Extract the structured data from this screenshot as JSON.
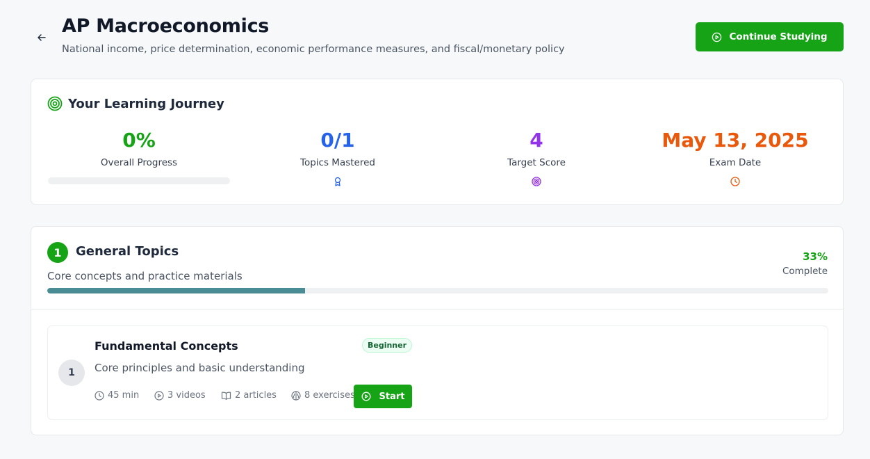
{
  "header": {
    "title": "AP Macroeconomics",
    "subtitle": "National income, price determination, economic performance measures, and fiscal/monetary policy",
    "continue_label": "Continue Studying"
  },
  "journey": {
    "title": "Your Learning Journey",
    "stats": [
      {
        "value": "0%",
        "label": "Overall Progress",
        "color": "#16a316",
        "progress": 0
      },
      {
        "value": "0/1",
        "label": "Topics Mastered",
        "color": "#2563eb",
        "icon": "award-icon"
      },
      {
        "value": "4",
        "label": "Target Score",
        "color": "#9333ea",
        "icon": "target-icon"
      },
      {
        "value": "May 13, 2025",
        "label": "Exam Date",
        "color": "#ea580c",
        "icon": "clock-icon"
      }
    ]
  },
  "section": {
    "number": "1",
    "title": "General Topics",
    "description": "Core concepts and practice materials",
    "percent": "33%",
    "percent_value": 33,
    "complete_label": "Complete",
    "topics": [
      {
        "number": "1",
        "title": "Fundamental Concepts",
        "level": "Beginner",
        "description": "Core principles and basic understanding",
        "duration": "45 min",
        "videos": "3 videos",
        "articles": "2 articles",
        "exercises": "8 exercises",
        "start_label": "Start"
      }
    ]
  },
  "colors": {
    "accent": "#16a316",
    "section_progress": "#4a8c94"
  }
}
